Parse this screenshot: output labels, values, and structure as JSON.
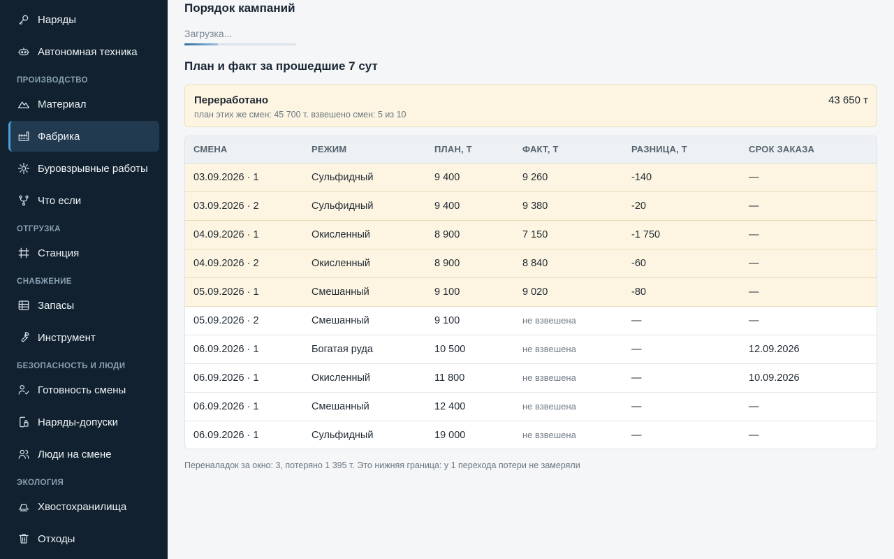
{
  "sidebar": {
    "items": [
      {
        "label": "Наряды",
        "icon": "key-icon"
      },
      {
        "label": "Автономная техника",
        "icon": "robot-icon"
      },
      {
        "label": "Материал",
        "icon": "mountain-icon"
      },
      {
        "label": "Фабрика",
        "icon": "factory-icon"
      },
      {
        "label": "Буровзрывные работы",
        "icon": "burst-icon"
      },
      {
        "label": "Что если",
        "icon": "branch-icon"
      },
      {
        "label": "Станция",
        "icon": "rail-icon"
      },
      {
        "label": "Запасы",
        "icon": "warehouse-icon"
      },
      {
        "label": "Инструмент",
        "icon": "wrench-icon"
      },
      {
        "label": "Готовность смены",
        "icon": "user-check-icon"
      },
      {
        "label": "Наряды-допуски",
        "icon": "permit-icon"
      },
      {
        "label": "Люди на смене",
        "icon": "users-icon"
      },
      {
        "label": "Хвостохранилища",
        "icon": "tailings-icon"
      },
      {
        "label": "Отходы",
        "icon": "trash-icon"
      }
    ],
    "sections": {
      "production": "Производство",
      "shipping": "Отгрузка",
      "supply": "Снабжение",
      "safety": "Безопасность и люди",
      "ecology": "Экология"
    },
    "active_item": "Фабрика"
  },
  "main": {
    "campaign_title": "Порядок кампаний",
    "loading_text": "Загрузка...",
    "loading_progress": 0.3,
    "plan_fact_title": "План и факт за прошедшие 7 сут",
    "summary": {
      "title": "Переработано",
      "subtitle": "план этих же смен: 45 700 т. взвешено смен: 5 из 10",
      "value": "43 650 т"
    },
    "table": {
      "headers": [
        "Смена",
        "Режим",
        "План, т",
        "Факт, т",
        "Разница, т",
        "Срок заказа"
      ],
      "rows": [
        {
          "shift": "03.09.2026 · 1",
          "mode": "Сульфидный",
          "plan": "9 400",
          "fact": "9 260",
          "diff": "-140",
          "due": "—",
          "weighed": true
        },
        {
          "shift": "03.09.2026 · 2",
          "mode": "Сульфидный",
          "plan": "9 400",
          "fact": "9 380",
          "diff": "-20",
          "due": "—",
          "weighed": true
        },
        {
          "shift": "04.09.2026 · 1",
          "mode": "Окисленный",
          "plan": "8 900",
          "fact": "7 150",
          "diff": "-1 750",
          "due": "—",
          "weighed": true
        },
        {
          "shift": "04.09.2026 · 2",
          "mode": "Окисленный",
          "plan": "8 900",
          "fact": "8 840",
          "diff": "-60",
          "due": "—",
          "weighed": true
        },
        {
          "shift": "05.09.2026 · 1",
          "mode": "Смешанный",
          "plan": "9 100",
          "fact": "9 020",
          "diff": "-80",
          "due": "—",
          "weighed": true
        },
        {
          "shift": "05.09.2026 · 2",
          "mode": "Смешанный",
          "plan": "9 100",
          "fact": "не взвешена",
          "diff": "—",
          "due": "—",
          "weighed": false
        },
        {
          "shift": "06.09.2026 · 1",
          "mode": "Богатая руда",
          "plan": "10 500",
          "fact": "не взвешена",
          "diff": "—",
          "due": "12.09.2026",
          "weighed": false
        },
        {
          "shift": "06.09.2026 · 1",
          "mode": "Окисленный",
          "plan": "11 800",
          "fact": "не взвешена",
          "diff": "—",
          "due": "10.09.2026",
          "weighed": false
        },
        {
          "shift": "06.09.2026 · 1",
          "mode": "Смешанный",
          "plan": "12 400",
          "fact": "не взвешена",
          "diff": "—",
          "due": "—",
          "weighed": false
        },
        {
          "shift": "06.09.2026 · 1",
          "mode": "Сульфидный",
          "plan": "19 000",
          "fact": "не взвешена",
          "diff": "—",
          "due": "—",
          "weighed": false
        }
      ]
    },
    "footnote": "Переналадок за окно: 3, потеряно 1 395 т. Это нижняя граница: у 1 перехода потери не замеряли"
  },
  "colors": {
    "sidebar_bg": "#11212f",
    "active_bg": "#223a50",
    "accent": "#4aa3df",
    "highlight_row": "#fdf5e1"
  }
}
